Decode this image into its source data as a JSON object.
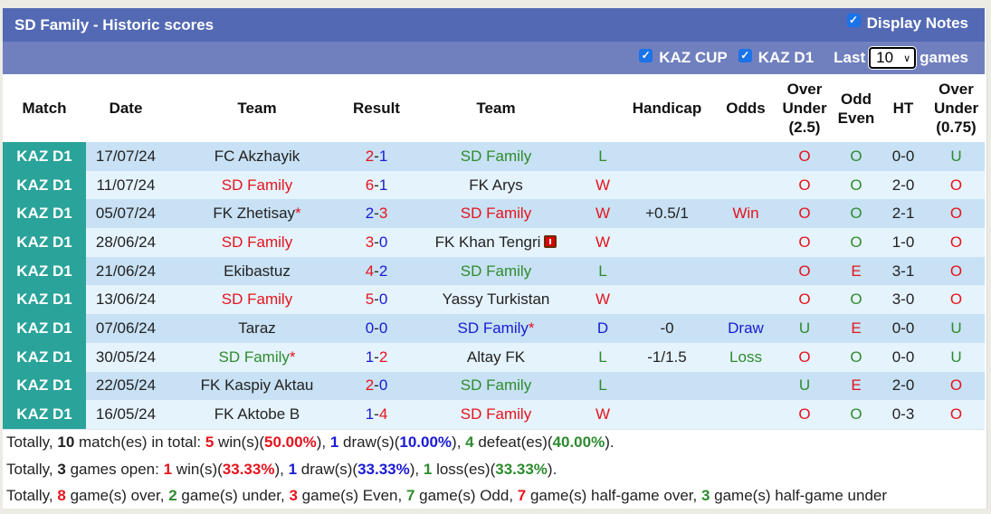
{
  "header": {
    "title": "SD Family - Historic scores",
    "display_notes_label": "Display Notes",
    "display_notes_checked": true
  },
  "filters": {
    "kaz_cup_label": "KAZ CUP",
    "kaz_cup_checked": true,
    "kaz_d1_label": "KAZ D1",
    "kaz_d1_checked": true,
    "last_label": "Last",
    "games_count": "10",
    "games_label": "games"
  },
  "columns": [
    "Match",
    "Date",
    "Team",
    "Result",
    "Team",
    "",
    "Handicap",
    "Odds",
    "Over Under (2.5)",
    "Odd Even",
    "HT",
    "Over Under (0.75)"
  ],
  "column_lines": {
    "ou25": [
      "Over",
      "Under",
      "(2.5)"
    ],
    "oe": [
      "Odd",
      "Even"
    ],
    "ou075": [
      "Over",
      "Under",
      "(0.75)"
    ]
  },
  "colors": {
    "league_badge": "#2aa39a",
    "title_bar": "#5369b4",
    "filter_bar": "#7080be",
    "row_dark": "#c8e1f4",
    "row_light": "#e5f3fc",
    "win": "#e5131d",
    "loss": "#2e8b2e",
    "draw": "#1a1ad4"
  },
  "matches": [
    {
      "league": "KAZ D1",
      "date": "17/07/24",
      "home": "FC Akzhayik",
      "home_color": "dark",
      "home_star": false,
      "score_home": "2",
      "score_home_color": "red",
      "score_away": "1",
      "score_away_color": "blue",
      "away": "SD Family",
      "away_color": "green",
      "away_star": false,
      "away_redcard": false,
      "result": "L",
      "result_color": "green",
      "handicap": "",
      "odds": "",
      "odds_color": "dark",
      "ou": "O",
      "ou_color": "red",
      "oe": "O",
      "oe_color": "green",
      "ht": "0-0",
      "ou075": "U",
      "ou075_color": "green"
    },
    {
      "league": "KAZ D1",
      "date": "11/07/24",
      "home": "SD Family",
      "home_color": "red",
      "home_star": false,
      "score_home": "6",
      "score_home_color": "red",
      "score_away": "1",
      "score_away_color": "blue",
      "away": "FK Arys",
      "away_color": "dark",
      "away_star": false,
      "away_redcard": false,
      "result": "W",
      "result_color": "red",
      "handicap": "",
      "odds": "",
      "odds_color": "dark",
      "ou": "O",
      "ou_color": "red",
      "oe": "O",
      "oe_color": "green",
      "ht": "2-0",
      "ou075": "O",
      "ou075_color": "red"
    },
    {
      "league": "KAZ D1",
      "date": "05/07/24",
      "home": "FK Zhetisay",
      "home_color": "dark",
      "home_star": true,
      "score_home": "2",
      "score_home_color": "blue",
      "score_away": "3",
      "score_away_color": "red",
      "away": "SD Family",
      "away_color": "red",
      "away_star": false,
      "away_redcard": false,
      "result": "W",
      "result_color": "red",
      "handicap": "+0.5/1",
      "odds": "Win",
      "odds_color": "red",
      "ou": "O",
      "ou_color": "red",
      "oe": "O",
      "oe_color": "green",
      "ht": "2-1",
      "ou075": "O",
      "ou075_color": "red"
    },
    {
      "league": "KAZ D1",
      "date": "28/06/24",
      "home": "SD Family",
      "home_color": "red",
      "home_star": false,
      "score_home": "3",
      "score_home_color": "red",
      "score_away": "0",
      "score_away_color": "blue",
      "away": "FK Khan Tengri",
      "away_color": "dark",
      "away_star": false,
      "away_redcard": true,
      "result": "W",
      "result_color": "red",
      "handicap": "",
      "odds": "",
      "odds_color": "dark",
      "ou": "O",
      "ou_color": "red",
      "oe": "O",
      "oe_color": "green",
      "ht": "1-0",
      "ou075": "O",
      "ou075_color": "red"
    },
    {
      "league": "KAZ D1",
      "date": "21/06/24",
      "home": "Ekibastuz",
      "home_color": "dark",
      "home_star": false,
      "score_home": "4",
      "score_home_color": "red",
      "score_away": "2",
      "score_away_color": "blue",
      "away": "SD Family",
      "away_color": "green",
      "away_star": false,
      "away_redcard": false,
      "result": "L",
      "result_color": "green",
      "handicap": "",
      "odds": "",
      "odds_color": "dark",
      "ou": "O",
      "ou_color": "red",
      "oe": "E",
      "oe_color": "red",
      "ht": "3-1",
      "ou075": "O",
      "ou075_color": "red"
    },
    {
      "league": "KAZ D1",
      "date": "13/06/24",
      "home": "SD Family",
      "home_color": "red",
      "home_star": false,
      "score_home": "5",
      "score_home_color": "red",
      "score_away": "0",
      "score_away_color": "blue",
      "away": "Yassy Turkistan",
      "away_color": "dark",
      "away_star": false,
      "away_redcard": false,
      "result": "W",
      "result_color": "red",
      "handicap": "",
      "odds": "",
      "odds_color": "dark",
      "ou": "O",
      "ou_color": "red",
      "oe": "O",
      "oe_color": "green",
      "ht": "3-0",
      "ou075": "O",
      "ou075_color": "red"
    },
    {
      "league": "KAZ D1",
      "date": "07/06/24",
      "home": "Taraz",
      "home_color": "dark",
      "home_star": false,
      "score_home": "0",
      "score_home_color": "blue",
      "score_away": "0",
      "score_away_color": "blue",
      "away": "SD Family",
      "away_color": "blue",
      "away_star": true,
      "away_redcard": false,
      "result": "D",
      "result_color": "blue",
      "handicap": "-0",
      "odds": "Draw",
      "odds_color": "blue",
      "ou": "U",
      "ou_color": "green",
      "oe": "E",
      "oe_color": "red",
      "ht": "0-0",
      "ou075": "U",
      "ou075_color": "green"
    },
    {
      "league": "KAZ D1",
      "date": "30/05/24",
      "home": "SD Family",
      "home_color": "green",
      "home_star": true,
      "score_home": "1",
      "score_home_color": "blue",
      "score_away": "2",
      "score_away_color": "red",
      "away": "Altay FK",
      "away_color": "dark",
      "away_star": false,
      "away_redcard": false,
      "result": "L",
      "result_color": "green",
      "handicap": "-1/1.5",
      "odds": "Loss",
      "odds_color": "green",
      "ou": "O",
      "ou_color": "red",
      "oe": "O",
      "oe_color": "green",
      "ht": "0-0",
      "ou075": "U",
      "ou075_color": "green"
    },
    {
      "league": "KAZ D1",
      "date": "22/05/24",
      "home": "FK Kaspiy Aktau",
      "home_color": "dark",
      "home_star": false,
      "score_home": "2",
      "score_home_color": "red",
      "score_away": "0",
      "score_away_color": "blue",
      "away": "SD Family",
      "away_color": "green",
      "away_star": false,
      "away_redcard": false,
      "result": "L",
      "result_color": "green",
      "handicap": "",
      "odds": "",
      "odds_color": "dark",
      "ou": "U",
      "ou_color": "green",
      "oe": "E",
      "oe_color": "red",
      "ht": "2-0",
      "ou075": "O",
      "ou075_color": "red"
    },
    {
      "league": "KAZ D1",
      "date": "16/05/24",
      "home": "FK Aktobe B",
      "home_color": "dark",
      "home_star": false,
      "score_home": "1",
      "score_home_color": "blue",
      "score_away": "4",
      "score_away_color": "red",
      "away": "SD Family",
      "away_color": "red",
      "away_star": false,
      "away_redcard": false,
      "result": "W",
      "result_color": "red",
      "handicap": "",
      "odds": "",
      "odds_color": "dark",
      "ou": "O",
      "ou_color": "red",
      "oe": "O",
      "oe_color": "green",
      "ht": "0-3",
      "ou075": "O",
      "ou075_color": "red"
    }
  ],
  "summary": [
    [
      {
        "t": "Totally, ",
        "c": ""
      },
      {
        "t": "10",
        "c": "b"
      },
      {
        "t": " match(es) in total: ",
        "c": ""
      },
      {
        "t": "5",
        "c": "b red"
      },
      {
        "t": " win(s)(",
        "c": ""
      },
      {
        "t": "50.00%",
        "c": "b red"
      },
      {
        "t": "), ",
        "c": ""
      },
      {
        "t": "1",
        "c": "b blue"
      },
      {
        "t": " draw(s)(",
        "c": ""
      },
      {
        "t": "10.00%",
        "c": "b blue"
      },
      {
        "t": "), ",
        "c": ""
      },
      {
        "t": "4",
        "c": "b green"
      },
      {
        "t": " defeat(es)(",
        "c": ""
      },
      {
        "t": "40.00%",
        "c": "b green"
      },
      {
        "t": ").",
        "c": ""
      }
    ],
    [
      {
        "t": "Totally, ",
        "c": ""
      },
      {
        "t": "3",
        "c": "b"
      },
      {
        "t": " games open: ",
        "c": ""
      },
      {
        "t": "1",
        "c": "b red"
      },
      {
        "t": " win(s)(",
        "c": ""
      },
      {
        "t": "33.33%",
        "c": "b red"
      },
      {
        "t": "), ",
        "c": ""
      },
      {
        "t": "1",
        "c": "b blue"
      },
      {
        "t": " draw(s)(",
        "c": ""
      },
      {
        "t": "33.33%",
        "c": "b blue"
      },
      {
        "t": "), ",
        "c": ""
      },
      {
        "t": "1",
        "c": "b green"
      },
      {
        "t": " loss(es)(",
        "c": ""
      },
      {
        "t": "33.33%",
        "c": "b green"
      },
      {
        "t": ").",
        "c": ""
      }
    ],
    [
      {
        "t": "Totally, ",
        "c": ""
      },
      {
        "t": "8",
        "c": "b red"
      },
      {
        "t": " game(s) over, ",
        "c": ""
      },
      {
        "t": "2",
        "c": "b green"
      },
      {
        "t": " game(s) under, ",
        "c": ""
      },
      {
        "t": "3",
        "c": "b red"
      },
      {
        "t": " game(s) Even, ",
        "c": ""
      },
      {
        "t": "7",
        "c": "b green"
      },
      {
        "t": " game(s) Odd, ",
        "c": ""
      },
      {
        "t": "7",
        "c": "b red"
      },
      {
        "t": " game(s) half-game over, ",
        "c": ""
      },
      {
        "t": "3",
        "c": "b green"
      },
      {
        "t": " game(s) half-game under",
        "c": ""
      }
    ]
  ]
}
